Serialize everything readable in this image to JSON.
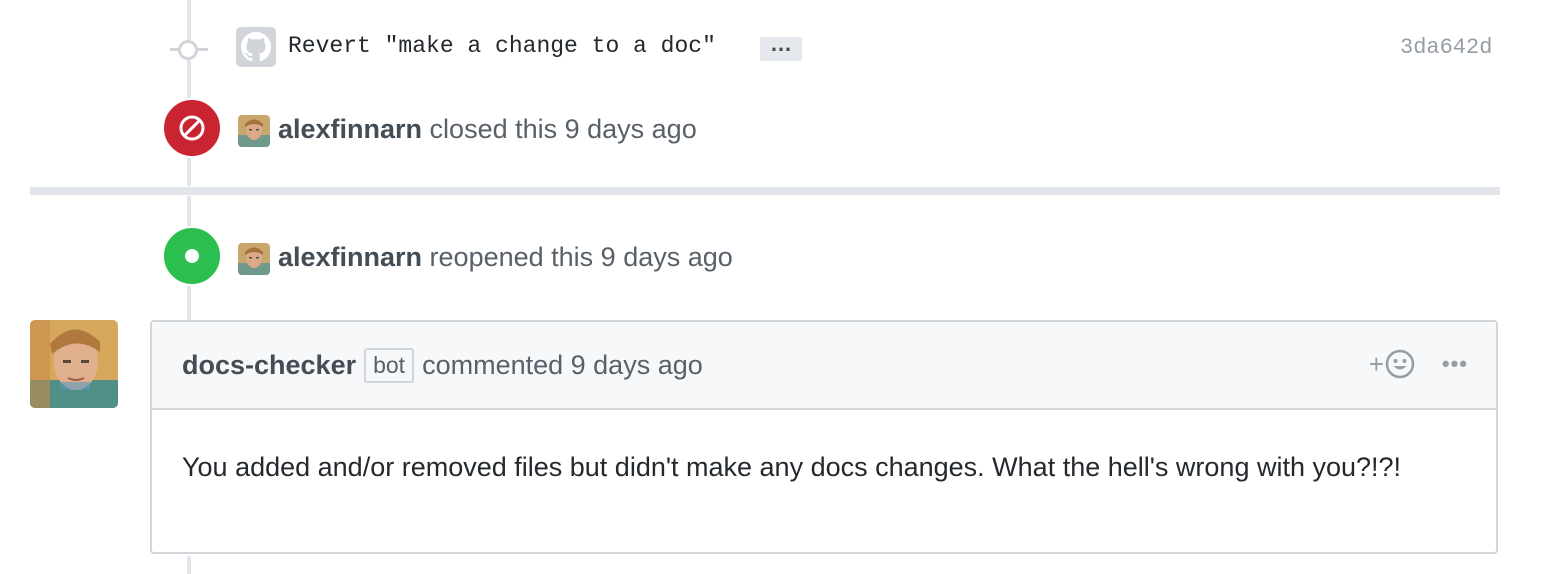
{
  "commit": {
    "message": "Revert \"make a change to a doc\"",
    "ellipsis": "…",
    "sha": "3da642d",
    "avatar_icon": "github-octocat-icon"
  },
  "closed_event": {
    "author": "alexfinnarn",
    "text": " closed this 9 days ago",
    "icon": "circle-slash-icon",
    "color": "#cb2431"
  },
  "reopened_event": {
    "author": "alexfinnarn",
    "text": " reopened this 9 days ago",
    "icon": "dot-icon",
    "color": "#2cbe4e"
  },
  "comment": {
    "author": "docs-checker",
    "bot_label": "bot",
    "meta": "commented 9 days ago",
    "reaction_plus": "+",
    "reaction_icon": "smiley-icon",
    "more_label": "•••",
    "body": "You added and/or removed files but didn't make any docs changes. What the hell's wrong with you?!?!"
  }
}
